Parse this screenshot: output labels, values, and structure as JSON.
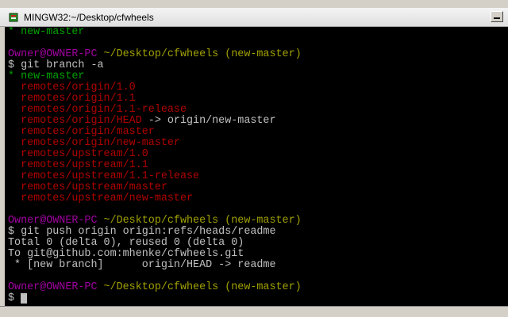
{
  "window": {
    "title": "MINGW32:~/Desktop/cfwheels",
    "icon": "git-bash-icon"
  },
  "terminal": {
    "lines": [
      [
        {
          "t": "* new-master",
          "c": "green"
        }
      ],
      [
        {
          "t": "",
          "c": "white"
        }
      ],
      [
        {
          "t": "Owner@OWNER-PC",
          "c": "purple"
        },
        {
          "t": " ~/Desktop/cfwheels",
          "c": "olive"
        },
        {
          "t": " (new-master)",
          "c": "olive"
        }
      ],
      [
        {
          "t": "$ git branch -a",
          "c": "white"
        }
      ],
      [
        {
          "t": "* new-master",
          "c": "green"
        }
      ],
      [
        {
          "t": "  remotes/origin/1.0",
          "c": "red"
        }
      ],
      [
        {
          "t": "  remotes/origin/1.1",
          "c": "red"
        }
      ],
      [
        {
          "t": "  remotes/origin/1.1-release",
          "c": "red"
        }
      ],
      [
        {
          "t": "  remotes/origin/HEAD",
          "c": "red"
        },
        {
          "t": " -> origin/new-master",
          "c": "white"
        }
      ],
      [
        {
          "t": "  remotes/origin/master",
          "c": "red"
        }
      ],
      [
        {
          "t": "  remotes/origin/new-master",
          "c": "red"
        }
      ],
      [
        {
          "t": "  remotes/upstream/1.0",
          "c": "red"
        }
      ],
      [
        {
          "t": "  remotes/upstream/1.1",
          "c": "red"
        }
      ],
      [
        {
          "t": "  remotes/upstream/1.1-release",
          "c": "red"
        }
      ],
      [
        {
          "t": "  remotes/upstream/master",
          "c": "red"
        }
      ],
      [
        {
          "t": "  remotes/upstream/new-master",
          "c": "red"
        }
      ],
      [
        {
          "t": "",
          "c": "white"
        }
      ],
      [
        {
          "t": "Owner@OWNER-PC",
          "c": "purple"
        },
        {
          "t": " ~/Desktop/cfwheels",
          "c": "olive"
        },
        {
          "t": " (new-master)",
          "c": "olive"
        }
      ],
      [
        {
          "t": "$ git push origin origin:refs/heads/readme",
          "c": "white"
        }
      ],
      [
        {
          "t": "Total 0 (delta 0), reused 0 (delta 0)",
          "c": "white"
        }
      ],
      [
        {
          "t": "To git@github.com:mhenke/cfwheels.git",
          "c": "white"
        }
      ],
      [
        {
          "t": " * [new branch]      origin/HEAD -> readme",
          "c": "white"
        }
      ],
      [
        {
          "t": "",
          "c": "white"
        }
      ],
      [
        {
          "t": "Owner@OWNER-PC",
          "c": "purple"
        },
        {
          "t": " ~/Desktop/cfwheels",
          "c": "olive"
        },
        {
          "t": " (new-master)",
          "c": "olive"
        }
      ],
      [
        {
          "t": "$ ",
          "c": "white"
        }
      ]
    ]
  }
}
